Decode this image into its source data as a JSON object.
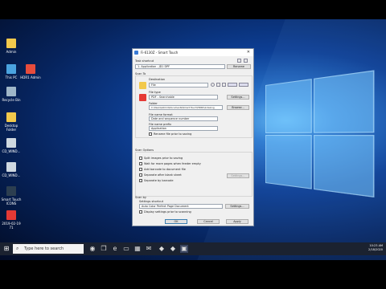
{
  "desktop": {
    "icons": [
      {
        "label": "Admin"
      },
      {
        "label": "This PC"
      },
      {
        "label": "HDR1 Admin"
      },
      {
        "label": "Recycle Bin"
      },
      {
        "label": "Desktop Folder"
      },
      {
        "label": "CD_WIND..."
      },
      {
        "label": "CD_WIND..."
      },
      {
        "label": "Smart Touch ICONS"
      },
      {
        "label": "2019-02-19 71"
      }
    ]
  },
  "window": {
    "title": "Fi-6130Z - Smart Touch",
    "task_shortcut_label": "Task shortcut",
    "task_shortcut_value": "1. Application - JD1 DPF",
    "rename_button": "Rename",
    "scan_to_label": "Scan To",
    "destination_label": "Destination",
    "destination_value": "File",
    "file_type_label": "File type",
    "file_type_value": "PDF - Searchable",
    "settings_button": "Settings...",
    "folder_label": "Folder",
    "folder_value": "C:\\Users\\Admin\\Documents\\Smart Touch\\HDR1\\Indexing",
    "browse_button": "Browse...",
    "file_name_format_label": "File name format",
    "file_name_format_value": "Date and sequence number",
    "file_name_prefix_label": "File name prefix",
    "file_name_prefix_value": "Application",
    "rename_file_prior": "Rename file prior to saving",
    "scan_options_label": "Scan Options",
    "scan_options": [
      "Split images prior to saving",
      "Wait for more pages when feeder empty",
      "Add barcode to document file",
      "Separate after blank sheet",
      "Separate by barcode"
    ],
    "options_settings_button": "Settings...",
    "scan_by_label": "Scan by",
    "settings_shortcut_label": "Settings shortcut",
    "settings_shortcut_value": "Auto Color Perfect Page Document",
    "settings_shortcut_button": "Settings...",
    "display_settings": "Display settings prior to scanning",
    "ok_button": "OK",
    "cancel_button": "Cancel",
    "apply_button": "Apply"
  },
  "taskbar": {
    "search_placeholder": "Type here to search",
    "time": "10:23 AM",
    "date": "2/18/2020"
  },
  "colors": {
    "accent": "#0a64c8",
    "taskbar": "#1b2230"
  }
}
